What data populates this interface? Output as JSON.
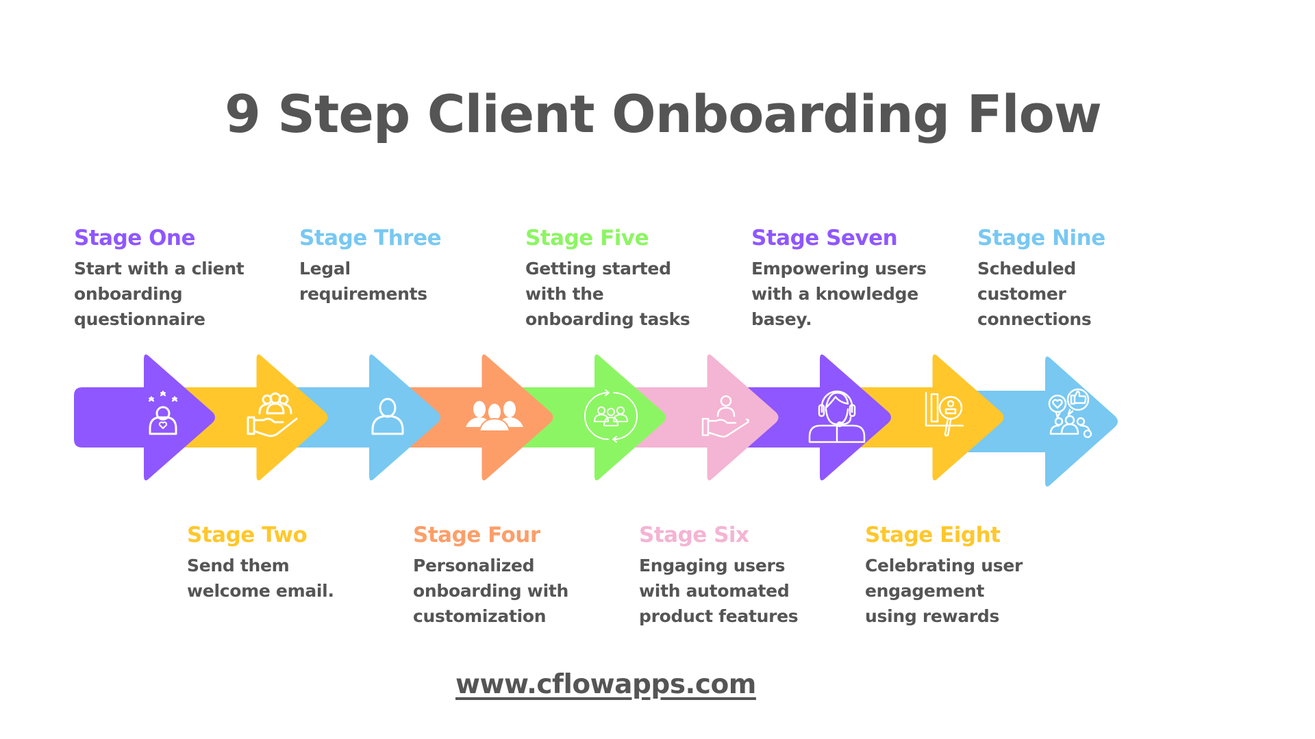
{
  "title": "9 Step Client Onboarding Flow",
  "colors": {
    "purple": "#8F57FF",
    "yellow": "#FFC72C",
    "blue": "#78C8F2",
    "orange": "#FD9E69",
    "green": "#8CF563",
    "pink": "#F4B4D3",
    "text": "#555555"
  },
  "stages": [
    {
      "label": "Stage One",
      "text_lines": [
        "Start with a client",
        "onboarding",
        "questionnaire"
      ],
      "color": "#8F57FF",
      "icon": "person-rating-stars-icon",
      "position": "top"
    },
    {
      "label": "Stage Two",
      "text_lines": [
        "Send them",
        "welcome email."
      ],
      "color": "#FFC72C",
      "icon": "hand-holding-group-icon",
      "position": "bottom"
    },
    {
      "label": "Stage Three",
      "text_lines": [
        "Legal",
        "requirements"
      ],
      "color": "#78C8F2",
      "icon": "user-icon",
      "position": "top"
    },
    {
      "label": "Stage Four",
      "text_lines": [
        "Personalized",
        "onboarding with",
        "customization"
      ],
      "color": "#FD9E69",
      "icon": "team-icon",
      "position": "bottom"
    },
    {
      "label": "Stage Five",
      "text_lines": [
        "Getting started",
        "with the",
        "onboarding tasks"
      ],
      "color": "#8CF563",
      "icon": "group-cycle-icon",
      "position": "top"
    },
    {
      "label": "Stage Six",
      "text_lines": [
        "Engaging users",
        "with automated",
        "product features"
      ],
      "color": "#F4B4D3",
      "icon": "hand-holding-user-icon",
      "position": "bottom"
    },
    {
      "label": "Stage Seven",
      "text_lines": [
        "Empowering users",
        "with a knowledge",
        "basey."
      ],
      "color": "#8F57FF",
      "icon": "support-agent-headset-icon",
      "position": "top"
    },
    {
      "label": "Stage Eight",
      "text_lines": [
        "Celebrating user",
        "engagement",
        "using rewards"
      ],
      "color": "#FFC72C",
      "icon": "chart-magnifier-user-icon",
      "position": "bottom"
    },
    {
      "label": "Stage Nine",
      "text_lines": [
        "Scheduled",
        "customer",
        "connections"
      ],
      "color": "#78C8F2",
      "icon": "community-feedback-icon",
      "position": "top"
    }
  ],
  "footer": {
    "url_text": "www.cflowapps.com"
  }
}
